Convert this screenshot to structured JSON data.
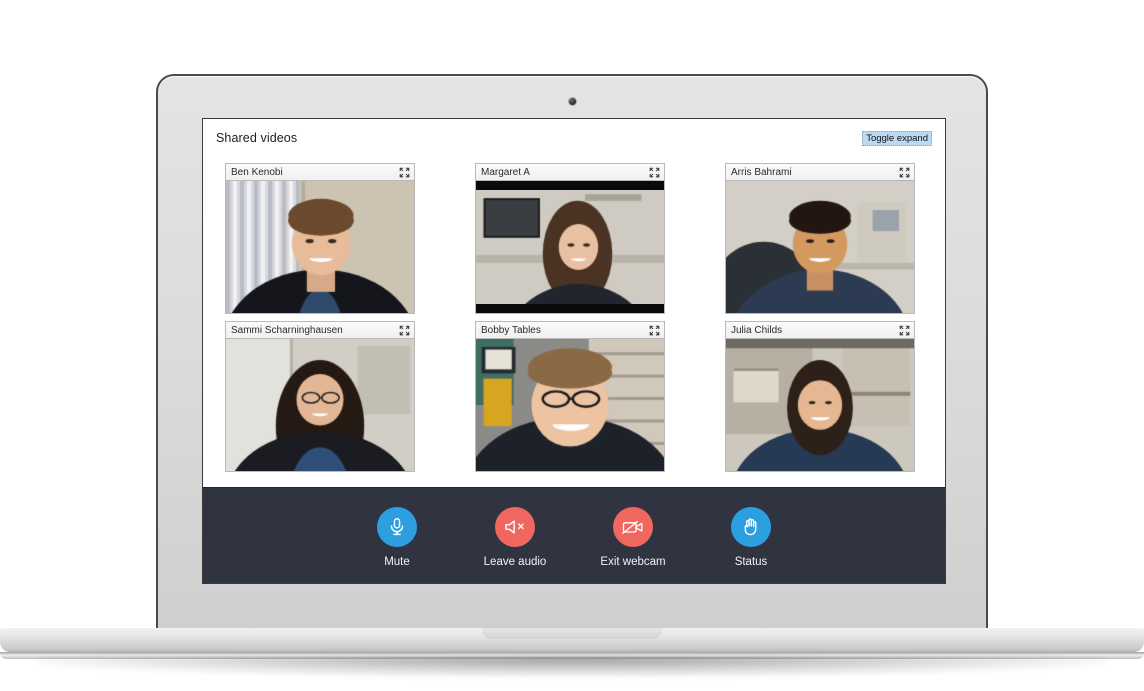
{
  "app": {
    "title": "Shared videos",
    "toggle_expand_label": "Toggle expand"
  },
  "colors": {
    "toolbar_bg": "#2f3440",
    "accent_blue": "#2d9fe0",
    "accent_red": "#f0675f",
    "tile_header_bg": "#f4f4f4",
    "highlight_bg": "#bcd9f2"
  },
  "videos": [
    {
      "name": "Ben Kenobi",
      "expand_icon": "expand-icon",
      "scene": "ben",
      "letterbox": false
    },
    {
      "name": "Margaret A",
      "expand_icon": "expand-icon",
      "scene": "margaret",
      "letterbox": true
    },
    {
      "name": "Arris Bahrami",
      "expand_icon": "expand-icon",
      "scene": "arris",
      "letterbox": false
    },
    {
      "name": "Sammi Scharninghausen",
      "expand_icon": "expand-icon",
      "scene": "sammi",
      "letterbox": false
    },
    {
      "name": "Bobby Tables",
      "expand_icon": "expand-icon",
      "scene": "bobby",
      "letterbox": false
    },
    {
      "name": "Julia Childs",
      "expand_icon": "expand-icon",
      "scene": "julia",
      "letterbox": false
    }
  ],
  "toolbar": {
    "buttons": [
      {
        "label": "Mute",
        "icon": "microphone-icon",
        "color": "blue"
      },
      {
        "label": "Leave audio",
        "icon": "speaker-mute-icon",
        "color": "red"
      },
      {
        "label": "Exit webcam",
        "icon": "webcam-off-icon",
        "color": "red"
      },
      {
        "label": "Status",
        "icon": "raised-hand-icon",
        "color": "blue"
      }
    ]
  },
  "device": {
    "type": "laptop",
    "camera_icon": "laptop-camera-icon"
  }
}
